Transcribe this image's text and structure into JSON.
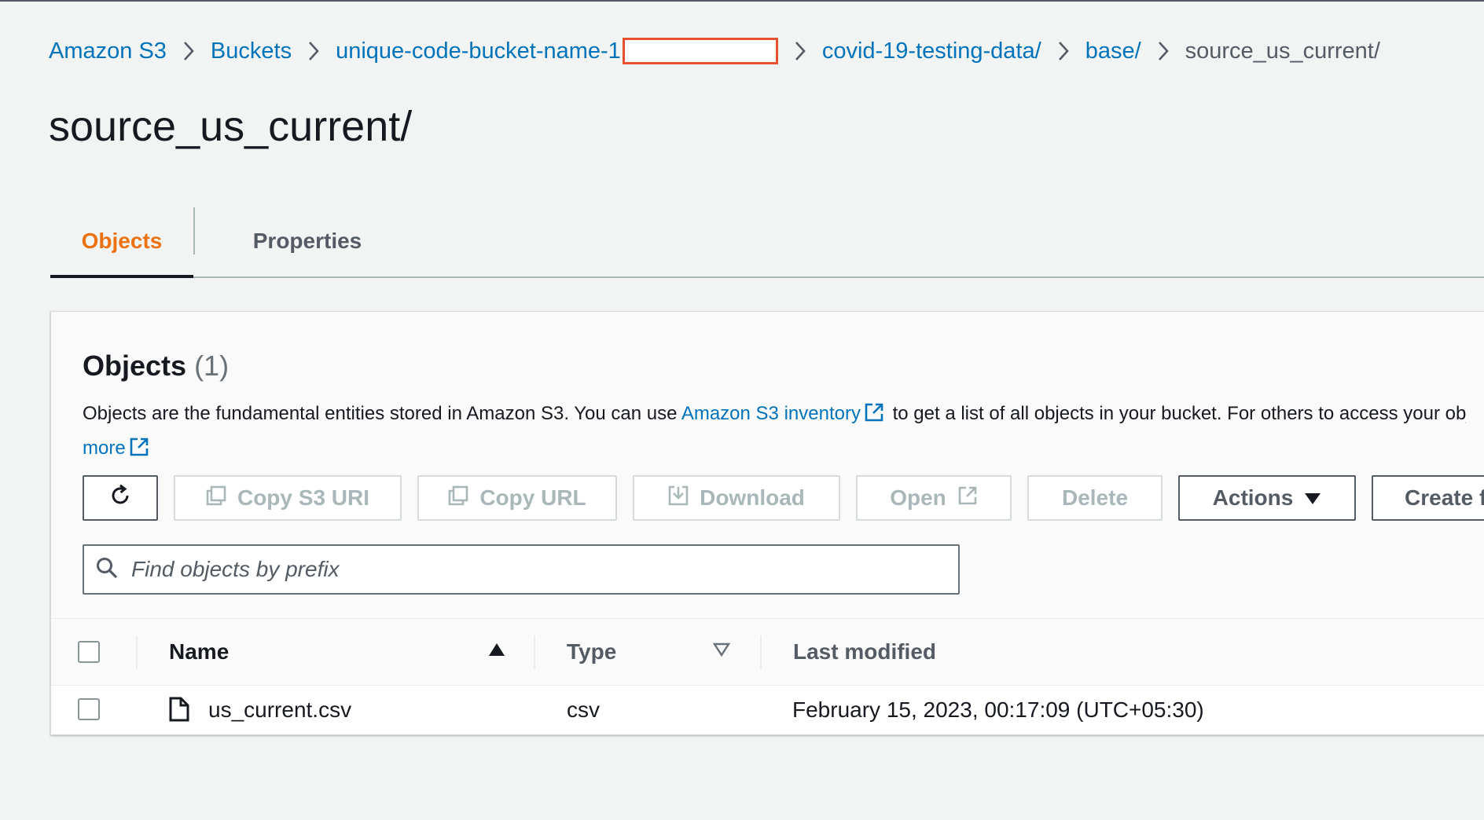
{
  "breadcrumb": {
    "items": [
      "Amazon S3",
      "Buckets",
      "unique-code-bucket-name-1",
      "covid-19-testing-data/",
      "base/"
    ],
    "current": "source_us_current/"
  },
  "page": {
    "title": "source_us_current/"
  },
  "tabs": {
    "objects": "Objects",
    "properties": "Properties"
  },
  "panel": {
    "title": "Objects",
    "count": "(1)",
    "desc_before": "Objects are the fundamental entities stored in Amazon S3. You can use ",
    "desc_link": "Amazon S3 inventory",
    "desc_after": " to get a list of all objects in your bucket. For others to access your objects, you'll need to explicitly grant them permissions.",
    "learn_more": "more"
  },
  "toolbar": {
    "copy_s3_uri": "Copy S3 URI",
    "copy_url": "Copy URL",
    "download": "Download",
    "open": "Open",
    "delete": "Delete",
    "actions": "Actions",
    "create": "Create folder"
  },
  "search": {
    "placeholder": "Find objects by prefix"
  },
  "table": {
    "columns": {
      "name": "Name",
      "type": "Type",
      "last_modified": "Last modified"
    },
    "rows": [
      {
        "name": "us_current.csv",
        "type": "csv",
        "last_modified": "February 15, 2023, 00:17:09 (UTC+05:30)"
      }
    ]
  },
  "colors": {
    "link": "#0073bb",
    "active_tab": "#ec7211",
    "redaction": "#e8512e"
  }
}
